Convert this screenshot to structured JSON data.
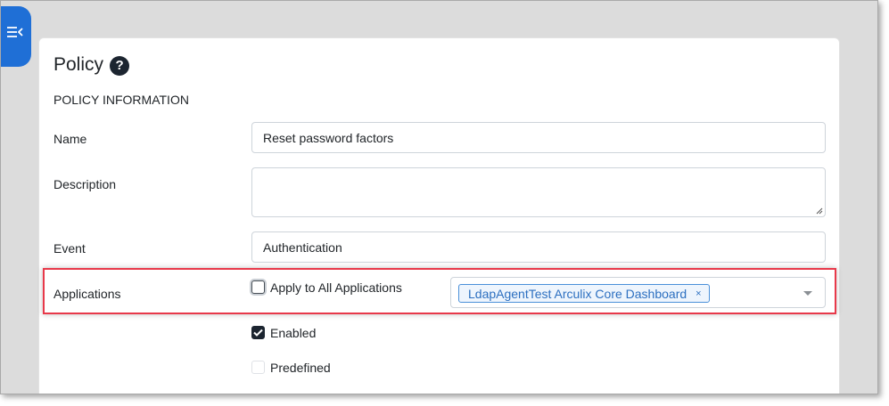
{
  "sidebar": {
    "toggle_icon": "menu-collapse-icon"
  },
  "page": {
    "title": "Policy",
    "help_icon": "question-icon",
    "help_glyph": "?"
  },
  "section": {
    "heading": "POLICY INFORMATION"
  },
  "form": {
    "name": {
      "label": "Name",
      "value": "Reset password factors"
    },
    "description": {
      "label": "Description",
      "value": ""
    },
    "event": {
      "label": "Event",
      "value": "Authentication"
    },
    "applications": {
      "label": "Applications",
      "apply_all_label": "Apply to All Applications",
      "apply_all_checked": false,
      "selected": [
        "LdapAgentTest Arculix Core Dashboard"
      ],
      "remove_glyph": "×"
    },
    "enabled": {
      "label": "Enabled",
      "checked": true
    },
    "predefined": {
      "label": "Predefined",
      "checked": false,
      "disabled": true
    }
  },
  "colors": {
    "accent": "#1f6fd6",
    "checkbox_checked": "#1c2530",
    "highlight": "#e8394a",
    "tag_border": "#4a90d9",
    "tag_text": "#2c6fc0"
  }
}
